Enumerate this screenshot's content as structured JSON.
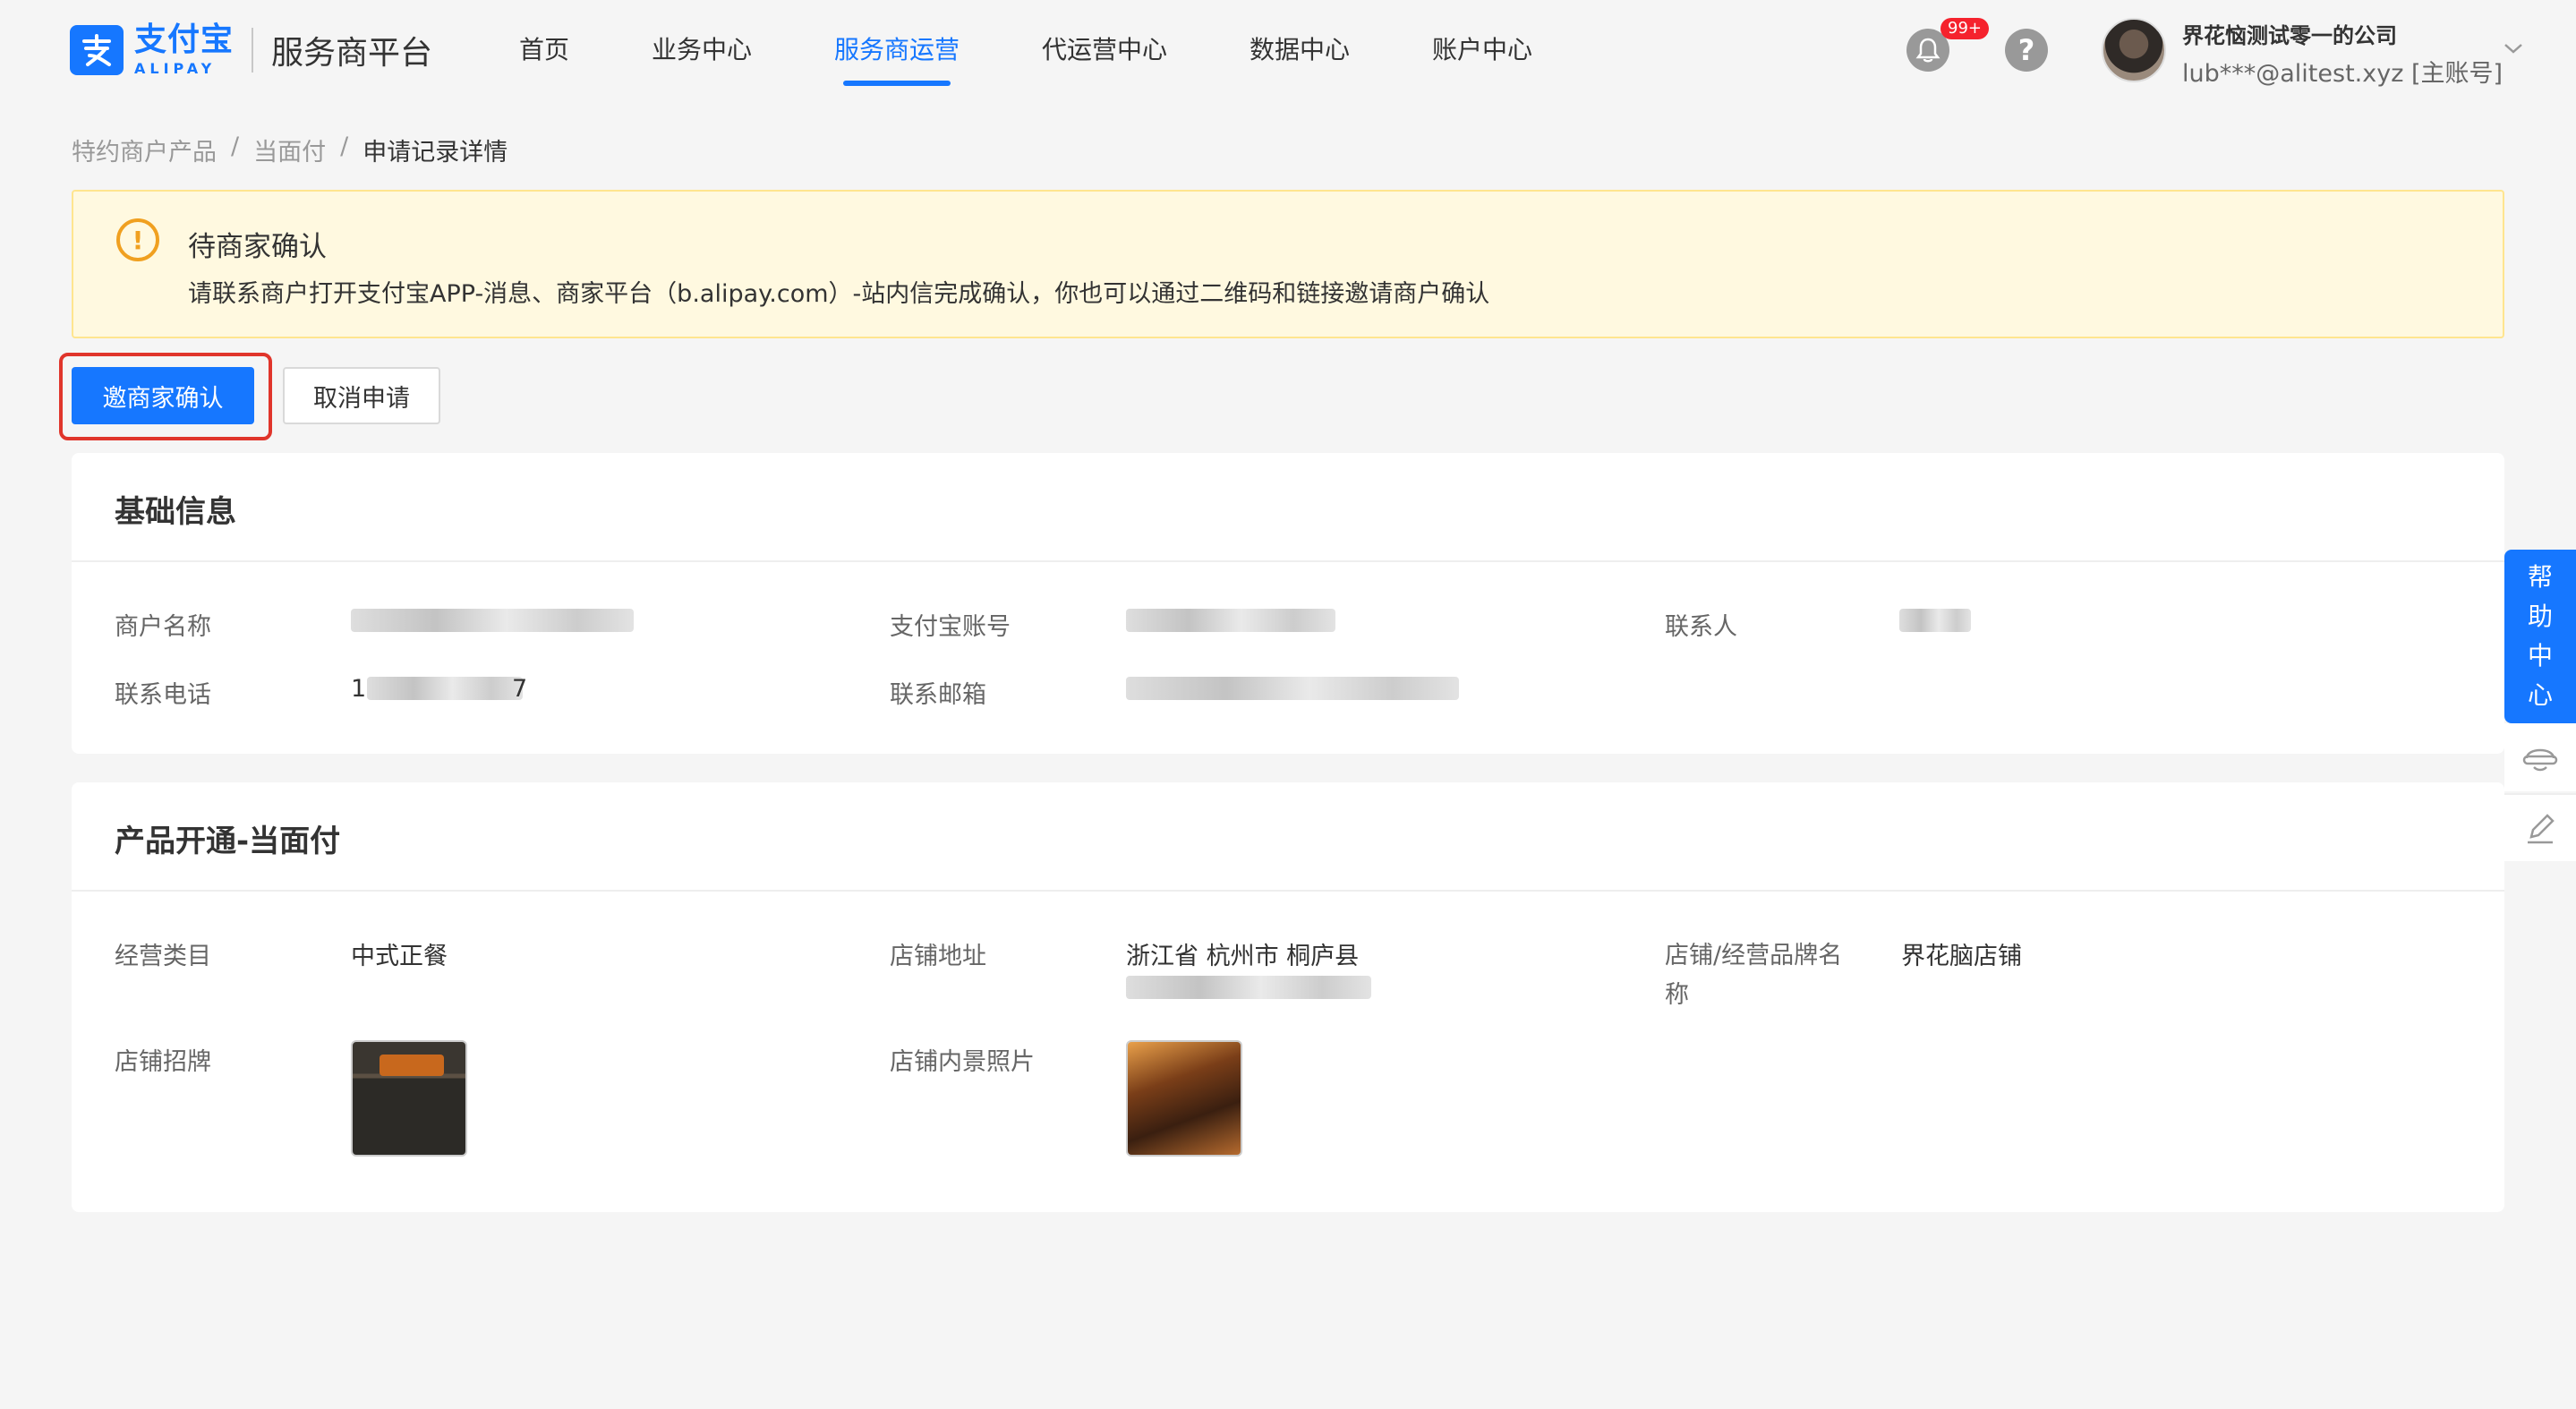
{
  "header": {
    "logo_cn": "支付宝",
    "logo_en": "ALIPAY",
    "platform_title": "服务商平台",
    "nav": [
      {
        "label": "首页",
        "active": false
      },
      {
        "label": "业务中心",
        "active": false
      },
      {
        "label": "服务商运营",
        "active": true
      },
      {
        "label": "代运营中心",
        "active": false
      },
      {
        "label": "数据中心",
        "active": false
      },
      {
        "label": "账户中心",
        "active": false
      }
    ],
    "notification_badge": "99+",
    "help_symbol": "?",
    "user_company": "界花恼测试零一的公司",
    "user_account": "lub***@alitest.xyz [主账号]",
    "icons": {
      "bell": "bell-icon",
      "help": "question-circle-icon",
      "chevron": "chevron-down-icon"
    }
  },
  "breadcrumb": {
    "items": [
      "特约商户产品",
      "当面付",
      "申请记录详情"
    ],
    "separator": "/"
  },
  "alert": {
    "icon_symbol": "!",
    "title": "待商家确认",
    "description": "请联系商户打开支付宝APP-消息、商家平台（b.alipay.com）-站内信完成确认，你也可以通过二维码和链接邀请商户确认"
  },
  "actions": {
    "primary_label": "邀商家确认",
    "secondary_label": "取消申请"
  },
  "basic_info": {
    "title": "基础信息",
    "fields": [
      {
        "label": "商户名称",
        "value": ""
      },
      {
        "label": "支付宝账号",
        "value": ""
      },
      {
        "label": "联系人",
        "value": ""
      },
      {
        "label": "联系电话",
        "value_prefix": "1",
        "value_suffix": "7"
      },
      {
        "label": "联系邮箱",
        "value": ""
      }
    ]
  },
  "product_info": {
    "title": "产品开通-当面付",
    "fields": [
      {
        "label": "经营类目",
        "value": "中式正餐"
      },
      {
        "label": "店铺地址",
        "value": "浙江省 杭州市 桐庐县"
      },
      {
        "label": "店铺/经营品牌名称",
        "value": "界花脑店铺"
      },
      {
        "label": "店铺招牌",
        "value": ""
      },
      {
        "label": "店铺内景照片",
        "value": ""
      }
    ]
  },
  "side_help": {
    "label_chars": [
      "帮",
      "助",
      "中",
      "心"
    ],
    "tools": [
      "headset-icon",
      "edit-icon"
    ]
  },
  "colors": {
    "primary": "#1677ff",
    "alert_bg": "#fff9e0",
    "alert_border": "#ffe58f",
    "alert_icon": "#f0a020",
    "highlight_border": "#e0352b",
    "badge": "#f5222d"
  }
}
